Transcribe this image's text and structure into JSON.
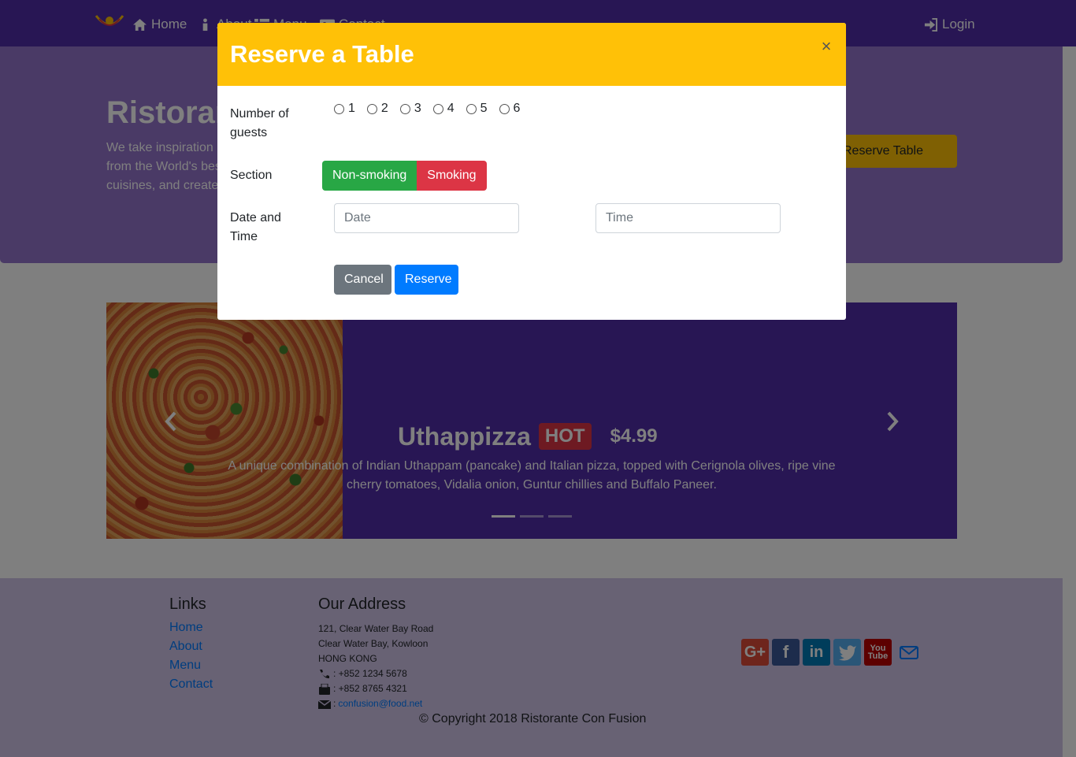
{
  "navbar": {
    "logo": "restaurant-logo",
    "items": [
      {
        "label": "Home",
        "icon": "home-icon"
      },
      {
        "label": "About",
        "icon": "info-icon"
      },
      {
        "label": "Menu",
        "icon": "list-icon"
      },
      {
        "label": "Contact",
        "icon": "address-card-icon"
      }
    ],
    "login": {
      "label": "Login",
      "icon": "sign-in-icon"
    }
  },
  "jumbotron": {
    "title": "Ristorante Con Fusion",
    "text": "We take inspiration from the World's best cuisines, and create a unique fusion experience. Our lipsmacking creations will tickle your culinary senses!",
    "reserve_label": "Reserve Table"
  },
  "carousel": {
    "dish_name": "Uthappizza",
    "badge": "HOT",
    "price": "$4.99",
    "description": "A unique combination of Indian Uthappam (pancake) and Italian pizza, topped with Cerignola olives, ripe vine cherry tomatoes, Vidalia onion, Guntur chillies and Buffalo Paneer.",
    "active_slide": 1,
    "slide_count": 3
  },
  "footer": {
    "links_heading": "Links",
    "links": [
      "Home",
      "About",
      "Menu",
      "Contact"
    ],
    "address_heading": "Our Address",
    "address_lines": [
      "121, Clear Water Bay Road",
      "Clear Water Bay, Kowloon",
      "HONG KONG"
    ],
    "phone": ": +852 1234 5678",
    "fax": ": +852 8765 4321",
    "email_prefix": ":",
    "email": "confusion@food.net",
    "social": [
      "google-plus-icon",
      "facebook-icon",
      "linkedin-icon",
      "twitter-icon",
      "youtube-icon",
      "mail-icon"
    ],
    "copyright": "© Copyright 2018 Ristorante Con Fusion"
  },
  "modal": {
    "title": "Reserve a Table",
    "close": "×",
    "guests_label": "Number of guests",
    "guests_options": [
      "1",
      "2",
      "3",
      "4",
      "5",
      "6"
    ],
    "section_label": "Section",
    "section_options": [
      "Non-smoking",
      "Smoking"
    ],
    "datetime_label": "Date and Time",
    "date_placeholder": "Date",
    "time_placeholder": "Time",
    "cancel_label": "Cancel",
    "reserve_label": "Reserve"
  },
  "colors": {
    "primary_purple": "#512da8",
    "light_purple": "#9575cd",
    "footer_purple": "#d1c4e9",
    "warning": "#ffc107",
    "success": "#28a745",
    "danger": "#dc3545",
    "secondary": "#6c757d",
    "primary": "#007bff"
  }
}
